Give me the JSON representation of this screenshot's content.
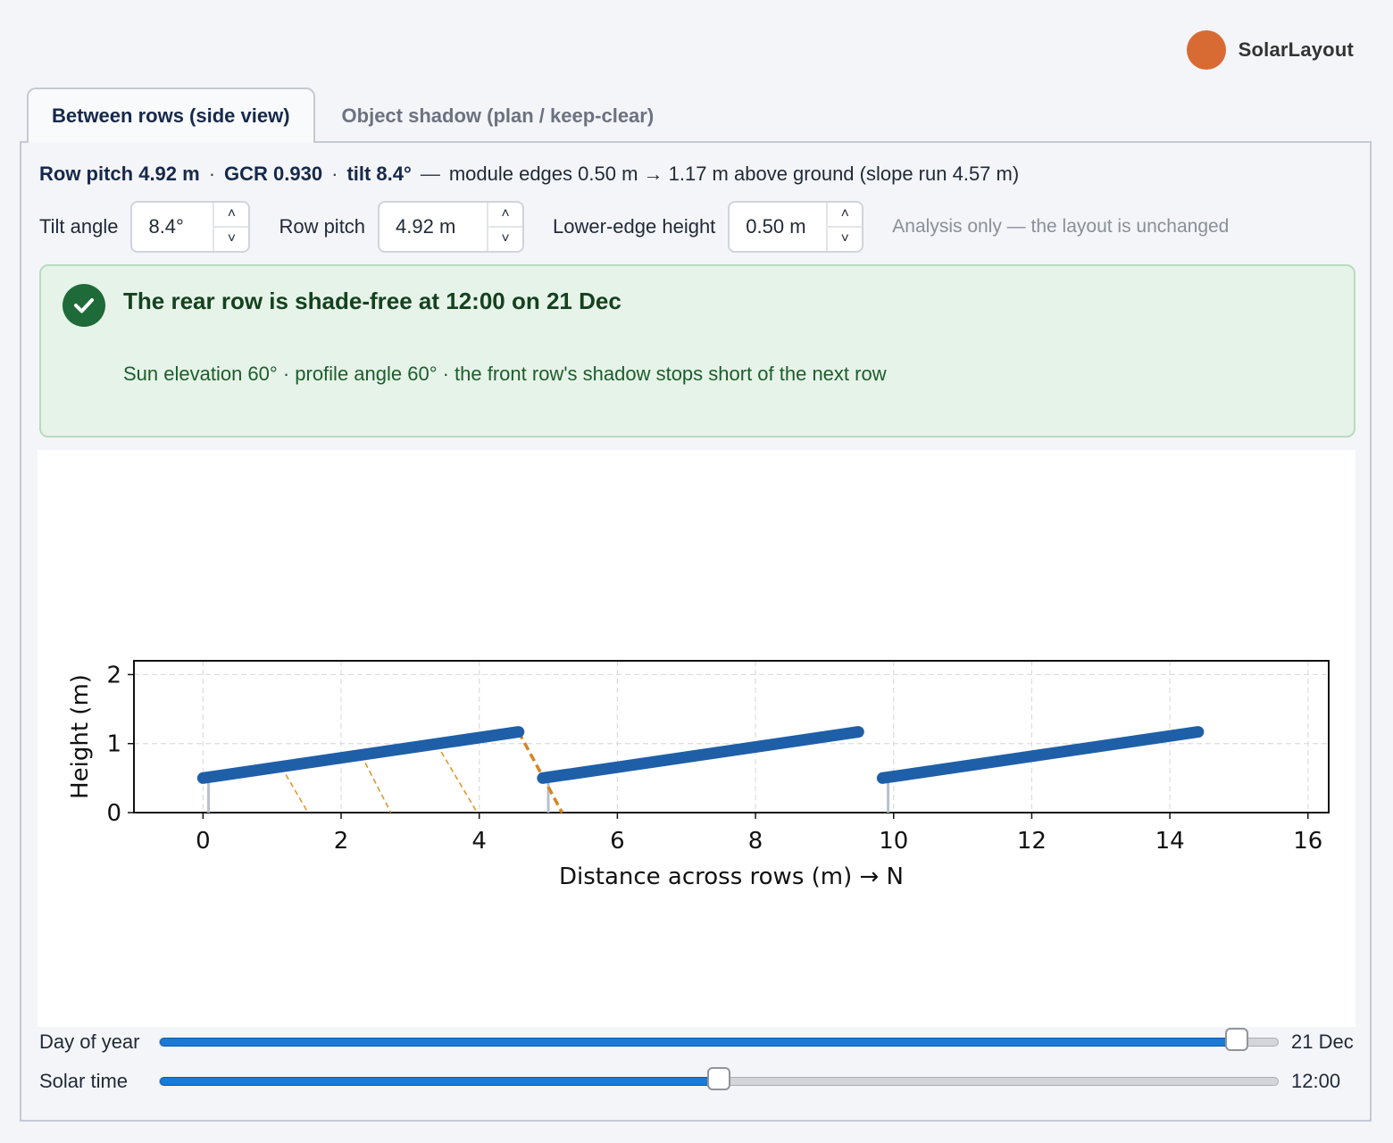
{
  "brand": {
    "name": "SolarLayout",
    "color": "#d86b34"
  },
  "tabs": [
    {
      "label": "Between rows (side view)",
      "active": true
    },
    {
      "label": "Object shadow (plan / keep-clear)",
      "active": false
    }
  ],
  "summary": {
    "pitch": "Row pitch 4.92 m",
    "gcr": "GCR 0.930",
    "tilt": "tilt 8.4°",
    "dot": "·",
    "dash": "—",
    "detail": "module edges 0.50 m → 1.17 m above ground (slope run 4.57 m)"
  },
  "controls": {
    "tilt": {
      "label": "Tilt angle",
      "value": "8.4°"
    },
    "pitch": {
      "label": "Row pitch",
      "value": "4.92 m"
    },
    "height": {
      "label": "Lower-edge height",
      "value": "0.50 m"
    },
    "note": "Analysis only — the layout is unchanged"
  },
  "status": {
    "title": "The rear row is shade-free at 12:00 on 21 Dec",
    "detail": "Sun elevation 60° · profile angle 60° · the front row's shadow stops short of the next row",
    "color": "#1e6b39"
  },
  "chart_data": {
    "type": "line",
    "xlabel": "Distance across rows (m)  →  N",
    "ylabel": "Height (m)",
    "xlim": [
      -1,
      16.3
    ],
    "ylim": [
      0,
      2.2
    ],
    "xticks": [
      0,
      2,
      4,
      6,
      8,
      10,
      12,
      14,
      16
    ],
    "yticks": [
      0,
      1,
      2
    ],
    "grid": true,
    "rows": [
      {
        "x": [
          0,
          4.57
        ],
        "y": [
          0.5,
          1.17
        ]
      },
      {
        "x": [
          4.92,
          9.49
        ],
        "y": [
          0.5,
          1.17
        ]
      },
      {
        "x": [
          9.84,
          14.41
        ],
        "y": [
          0.5,
          1.17
        ]
      }
    ],
    "post_x": [
      0.08,
      5.0,
      9.92
    ],
    "shadow_rays": [
      {
        "x": [
          1.2,
          1.52
        ],
        "y": [
          0.55,
          0
        ]
      },
      {
        "x": [
          2.35,
          2.72
        ],
        "y": [
          0.72,
          0
        ]
      },
      {
        "x": [
          3.45,
          3.97
        ],
        "y": [
          0.88,
          0
        ]
      }
    ],
    "front_shadow": {
      "x": [
        4.57,
        5.2
      ],
      "y": [
        1.17,
        0
      ]
    },
    "colors": {
      "row": "#1f5fa8",
      "shadow": "#e0982a",
      "front_shadow": "#d4861e",
      "post": "#b8c0cc"
    }
  },
  "sliders": {
    "day": {
      "label": "Day of year",
      "value": "21 Dec",
      "fraction": 0.963
    },
    "time": {
      "label": "Solar time",
      "value": "12:00",
      "fraction": 0.5
    }
  }
}
